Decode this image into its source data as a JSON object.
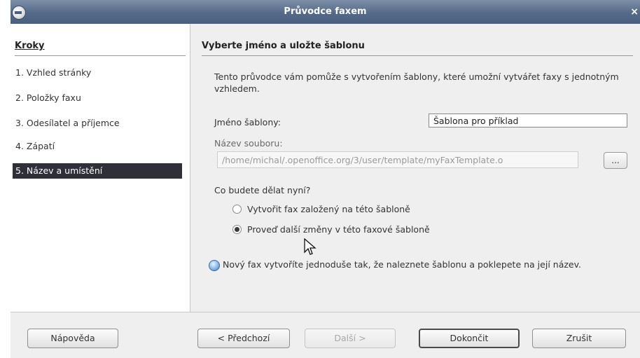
{
  "window": {
    "title": "Průvodce faxem",
    "close_glyph": "×"
  },
  "sidebar": {
    "title": "Kroky",
    "steps": [
      {
        "label": "1. Vzhled stránky"
      },
      {
        "label": "2. Položky faxu"
      },
      {
        "label": "3. Odesílatel a příjemce"
      },
      {
        "label": "4. Zápatí"
      },
      {
        "label": "5. Název a umístění",
        "active": true
      }
    ]
  },
  "main": {
    "title": "Vyberte jméno a uložte šablonu",
    "description": "Tento průvodce vám pomůže s vytvořením šablony, které umožní vytvářet faxy s jednotným vzhledem.",
    "template_name_label": "Jméno šablony:",
    "template_name_value": "Šablona pro příklad",
    "filename_label": "Název souboru:",
    "filename_value": "/home/michal/.openoffice.org/3/user/template/myFaxTemplate.o",
    "browse_label": "...",
    "question": "Co budete dělat nyní?",
    "options": [
      {
        "label": "Vytvořit fax založený na této šabloně",
        "selected": false
      },
      {
        "label": "Proveď další změny v této faxové šabloně",
        "selected": true
      }
    ],
    "info": "Nový fax vytvoříte jednoduše tak, že naleznete šablonu a poklepete na její název."
  },
  "buttons": {
    "help": "Nápověda",
    "back": "< Předchozí",
    "next": "Další >",
    "finish": "Dokončit",
    "cancel": "Zrušit"
  },
  "icons": {
    "app": "openoffice-icon",
    "info": "info-bulb-icon",
    "cursor": "mouse-pointer-icon"
  }
}
